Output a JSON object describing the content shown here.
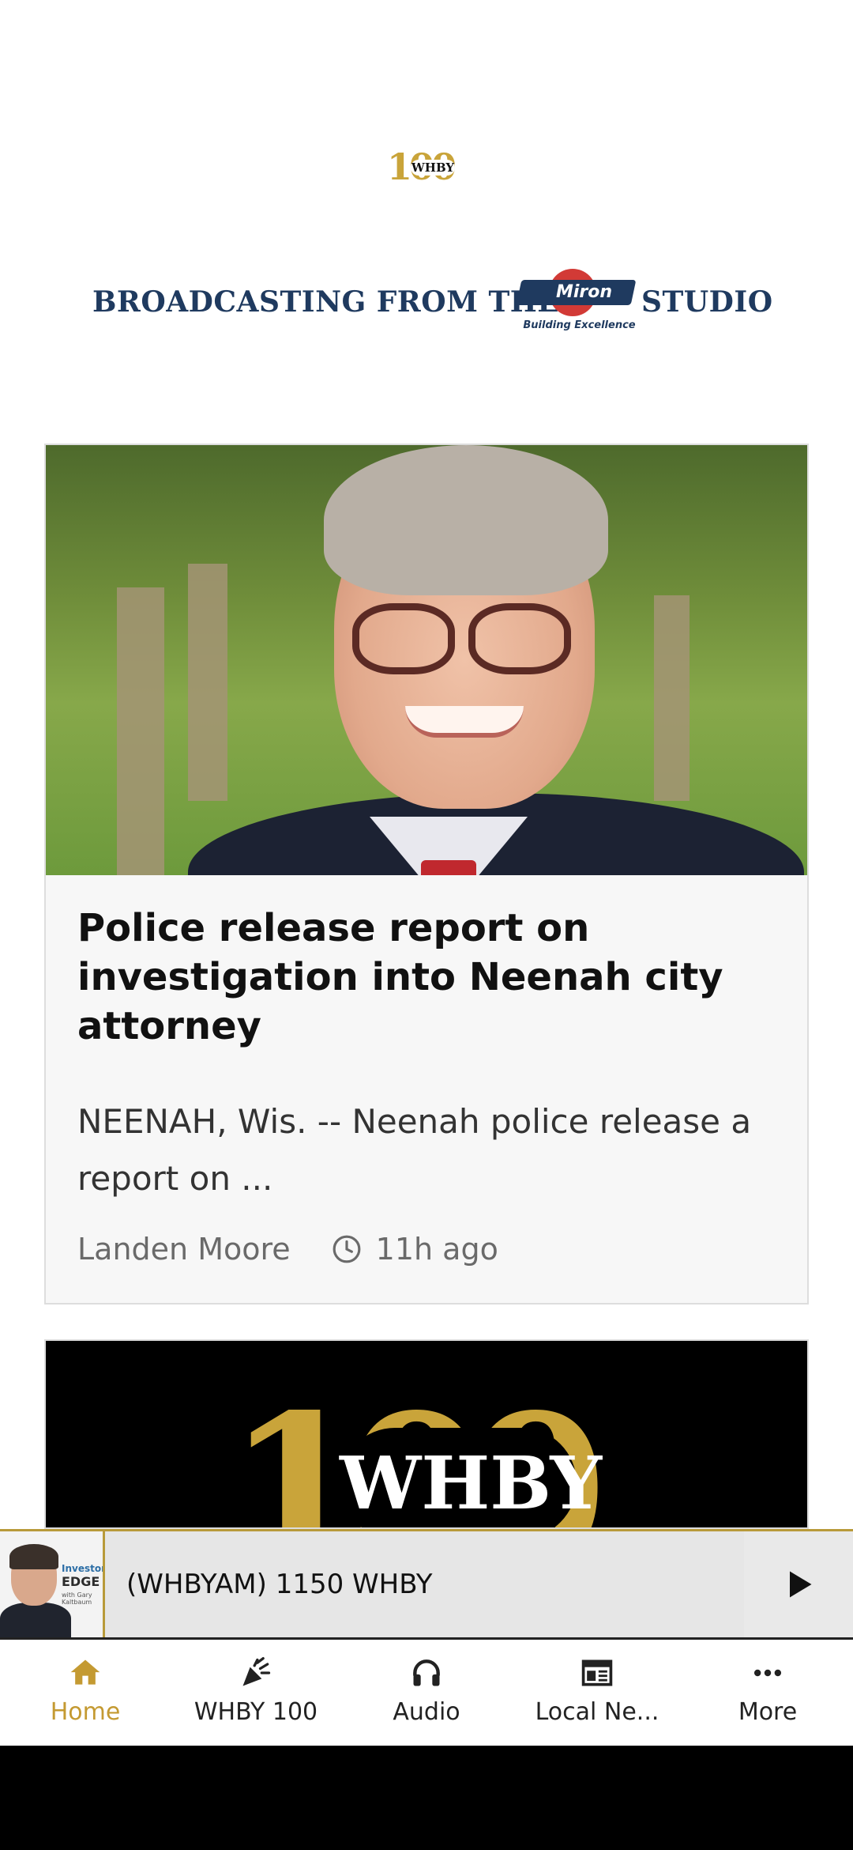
{
  "header": {
    "logo_number": "100",
    "logo_text": "WHBY"
  },
  "sponsor": {
    "left_text": "BROADCASTING FROM THE",
    "brand_name": "Miron",
    "brand_tagline": "Building Excellence",
    "right_text": "STUDIO"
  },
  "article": {
    "headline": "Police release report on investigation into Neenah city attorney",
    "excerpt": "NEENAH, Wis. -- Neenah police release a report on ...",
    "author": "Landen Moore",
    "time": "11h ago"
  },
  "next_card": {
    "logo_number": "100",
    "logo_text": "WHBY"
  },
  "player": {
    "station": "(WHBYAM) 1150 WHBY",
    "thumb_brand_line1": "Investor's",
    "thumb_brand_line2": "EDGE",
    "thumb_brand_line3": "with Gary Kaltbaum"
  },
  "bottom_nav": {
    "items": [
      {
        "label": "Home",
        "icon": "home-icon",
        "active": true
      },
      {
        "label": "WHBY 100",
        "icon": "celebration-icon",
        "active": false
      },
      {
        "label": "Audio",
        "icon": "headphones-icon",
        "active": false
      },
      {
        "label": "Local Ne...",
        "icon": "newspaper-icon",
        "active": false
      },
      {
        "label": "More",
        "icon": "more-dots-icon",
        "active": false
      }
    ]
  },
  "colors": {
    "accent": "#c49a32",
    "navy": "#1f3a5f",
    "miron_red": "#d23a36"
  }
}
